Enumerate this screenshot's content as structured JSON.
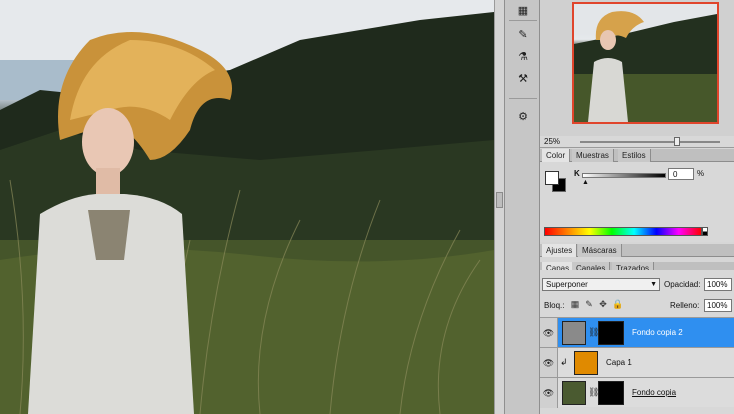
{
  "navigator": {
    "zoom": "25%"
  },
  "color_panel": {
    "tabs": [
      "Color",
      "Muestras",
      "Estilos"
    ],
    "active_tab": 0,
    "channel_label": "K",
    "channel_value": "0",
    "unit": "%",
    "foreground": "#ffffff",
    "background": "#000000"
  },
  "adjust_panel": {
    "tabs": [
      "Ajustes",
      "Máscaras"
    ],
    "active_tab": 0
  },
  "layers_panel": {
    "tabs": [
      "Capas",
      "Canales",
      "Trazados"
    ],
    "active_tab": 0,
    "blend_mode": "Superponer",
    "opacity_label": "Opacidad:",
    "opacity_value": "100%",
    "lock_label": "Bloq.:",
    "fill_label": "Relleno:",
    "fill_value": "100%",
    "layers": [
      {
        "name": "Fondo copia 2",
        "selected": true,
        "thumb_color": "#8a8a8a"
      },
      {
        "name": "Capa 1",
        "selected": false,
        "thumb_color": "#e08a00"
      },
      {
        "name": "Fondo copia",
        "selected": false,
        "thumb_color": "#4a5a30"
      }
    ]
  },
  "colors": {
    "selection_blue": "#2f8ff0",
    "navigator_frame": "#e0452c"
  }
}
